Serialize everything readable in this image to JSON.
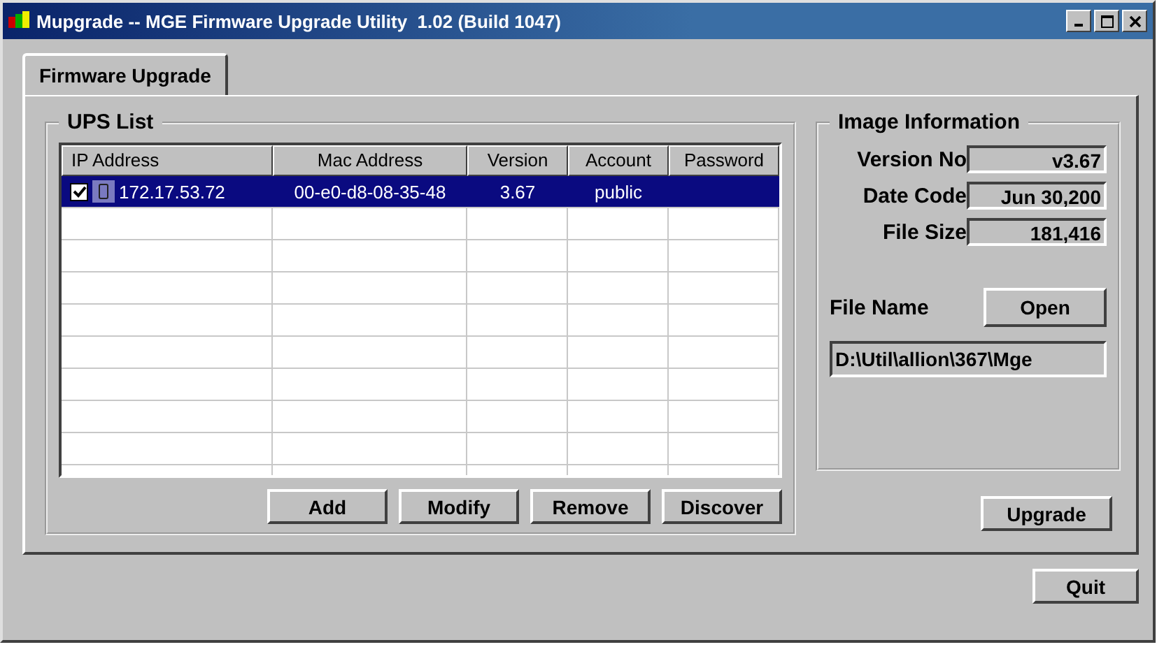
{
  "window": {
    "title": "Mupgrade -- MGE Firmware Upgrade Utility  1.02 (Build 1047)"
  },
  "tabs": [
    {
      "label": "Firmware Upgrade",
      "selected": true
    }
  ],
  "ups_list": {
    "title": "UPS List",
    "columns": [
      "IP Address",
      "Mac Address",
      "Version",
      "Account",
      "Password"
    ],
    "rows": [
      {
        "checked": true,
        "selected": true,
        "cells": [
          "172.17.53.72",
          "00-e0-d8-08-35-48",
          "3.67",
          "public",
          ""
        ]
      }
    ],
    "buttons": [
      "Add",
      "Modify",
      "Remove",
      "Discover"
    ]
  },
  "image_information": {
    "title": "Image Information",
    "fields": [
      {
        "label": "Version No",
        "value": "v3.67"
      },
      {
        "label": "Date Code",
        "value": "Jun 30,200"
      },
      {
        "label": "File Size",
        "value": "181,416"
      }
    ],
    "file_name_label": "File Name",
    "open_button": "Open",
    "file_name": "D:\\Util\\allion\\367\\Mge"
  },
  "upgrade_button": "Upgrade",
  "quit_button": "Quit"
}
